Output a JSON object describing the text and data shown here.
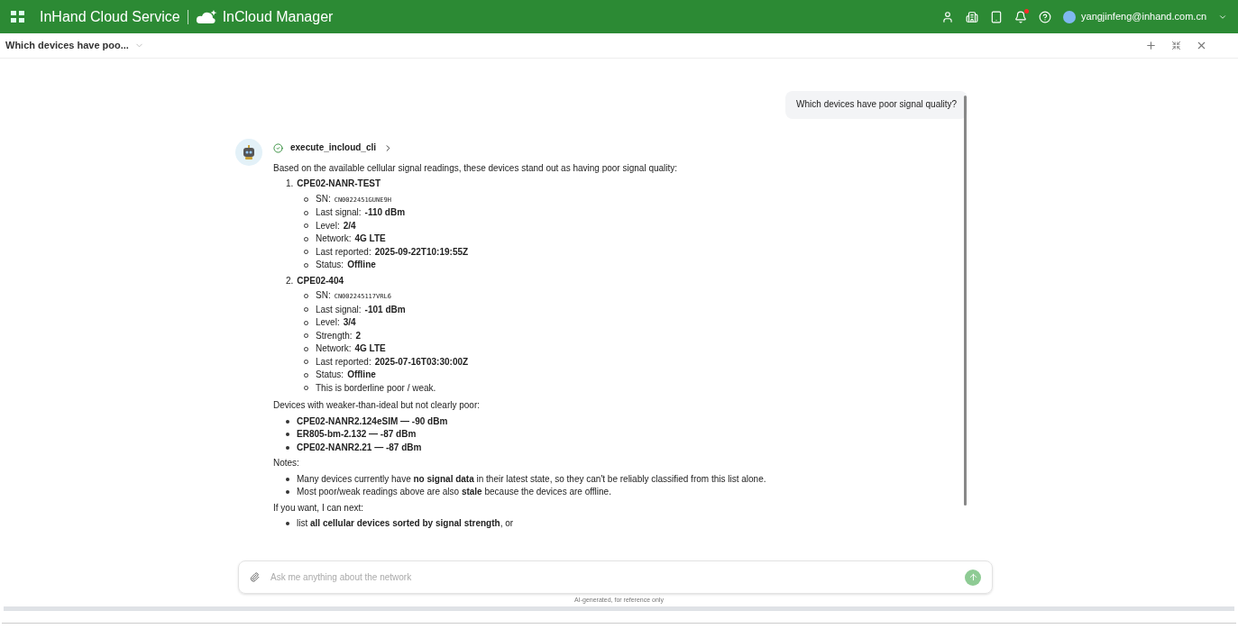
{
  "header": {
    "brand": "InHand Cloud Service",
    "product": "InCloud Manager",
    "user": "yangjinfeng@inhand.com.cn",
    "notification_dot": true
  },
  "tab": {
    "title": "Which devices have poo..."
  },
  "user_message": "Which devices have poor signal quality?",
  "tool_call": {
    "name": "execute_incloud_cli",
    "done": true
  },
  "intro": "Based on the available cellular signal readings, these devices stand out as having poor signal quality:",
  "devices": [
    {
      "number": "1.",
      "name": "CPE02-NANR-TEST",
      "details": [
        {
          "label": "SN:",
          "value": "CN0022451GUNE9H",
          "kind": "mono"
        },
        {
          "label": "Last signal:",
          "value": "-110 dBm",
          "kind": "bold"
        },
        {
          "label": "Level:",
          "value": "2/4",
          "kind": "bold"
        },
        {
          "label": "Network:",
          "value": "4G LTE",
          "kind": "bold"
        },
        {
          "label": "Last reported:",
          "value": "2025-09-22T10:19:55Z",
          "kind": "bold"
        },
        {
          "label": "Status:",
          "value": "Offline",
          "kind": "bold"
        }
      ]
    },
    {
      "number": "2.",
      "name": "CPE02-404",
      "details": [
        {
          "label": "SN:",
          "value": "CN002245117VRL6",
          "kind": "mono"
        },
        {
          "label": "Last signal:",
          "value": "-101 dBm",
          "kind": "bold"
        },
        {
          "label": "Level:",
          "value": "3/4",
          "kind": "bold"
        },
        {
          "label": "Strength:",
          "value": "2",
          "kind": "bold"
        },
        {
          "label": "Network:",
          "value": "4G LTE",
          "kind": "bold"
        },
        {
          "label": "Last reported:",
          "value": "2025-07-16T03:30:00Z",
          "kind": "bold"
        },
        {
          "label": "Status:",
          "value": "Offline",
          "kind": "bold"
        },
        {
          "label": "This is borderline poor / weak.",
          "kind": "plain"
        }
      ]
    }
  ],
  "weaker_heading": "Devices with weaker-than-ideal but not clearly poor:",
  "weaker": [
    "CPE02-NANR2.124eSIM — -90 dBm",
    "ER805-bm-2.132 — -87 dBm",
    "CPE02-NANR2.21 — -87 dBm"
  ],
  "notes_heading": "Notes:",
  "notes": [
    "Many devices currently have **no signal data** in their latest state, so they can't be reliably classified from this list alone.",
    "Most poor/weak readings above are also **stale** because the devices are offline."
  ],
  "next_heading": "If you want, I can next:",
  "next": [
    "list **all cellular devices sorted by signal strength**, or"
  ],
  "input": {
    "placeholder": "Ask me anything about the network"
  },
  "disclaimer": "AI-generated, for reference only"
}
